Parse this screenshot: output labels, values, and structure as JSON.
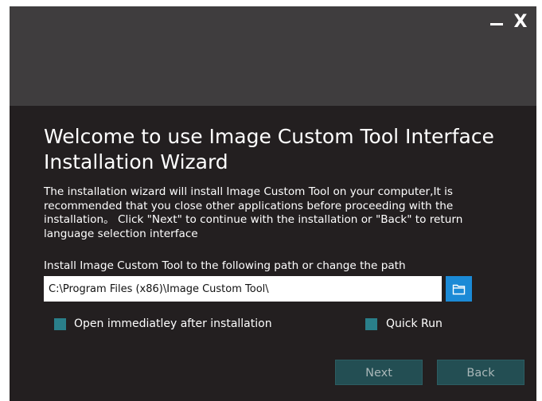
{
  "window": {
    "minimize_symbol": "",
    "close_symbol": "X"
  },
  "main": {
    "title": "Welcome to use Image Custom Tool Interface Installation Wizard",
    "description": "The installation wizard will install Image Custom Tool on your computer,It is recommended that you close other applications before proceeding with the installation。 Click \"Next\" to continue with the installation or \"Back\" to return language selection interface",
    "path_label": "Install Image Custom Tool to the following path or change the path",
    "path_value": "C:\\Program Files (x86)\\Image Custom Tool\\"
  },
  "options": [
    {
      "label": "Open immediatley after installation",
      "checked": true
    },
    {
      "label": "Quick Run",
      "checked": true
    }
  ],
  "buttons": {
    "next_label": "Next",
    "back_label": "Back"
  },
  "icons": {
    "minimize": "minimize-icon",
    "close": "close-icon",
    "browse": "folder-icon"
  },
  "colors": {
    "background": "#231f20",
    "header": "#3f3d3e",
    "accent": "#1b8ad6",
    "checkbox": "#2a7f8a",
    "button": "#234e53",
    "button_text": "#a9b7b8"
  }
}
